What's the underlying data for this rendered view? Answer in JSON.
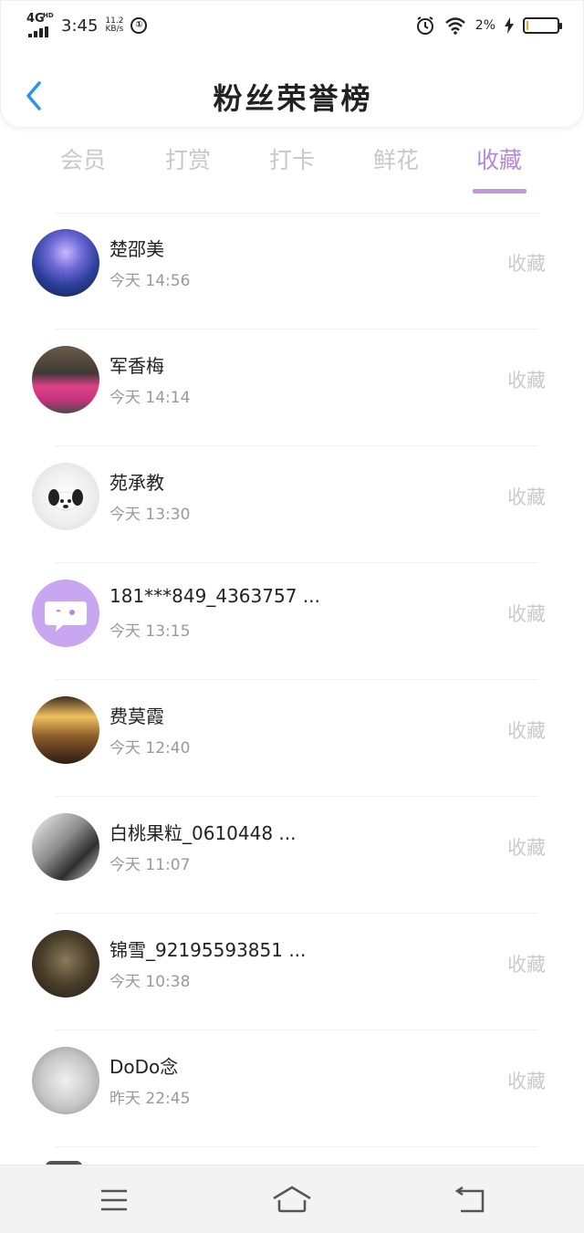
{
  "status_bar": {
    "network": "4G",
    "network_sub": "HD",
    "time": "3:45",
    "speed_value": "11.2",
    "speed_unit": "KB/s",
    "circle_icon": "①",
    "battery": "2%",
    "battery_fill": 0.02,
    "icons": [
      "alarm-icon",
      "wifi-icon",
      "charging-icon",
      "battery-icon"
    ]
  },
  "header": {
    "back_icon": "chevron-left-icon",
    "back_color": "#2a95e6",
    "title": "粉丝荣誉榜"
  },
  "tabs": {
    "items": [
      {
        "label": "会员"
      },
      {
        "label": "打赏"
      },
      {
        "label": "打卡"
      },
      {
        "label": "鲜花"
      },
      {
        "label": "收藏"
      }
    ],
    "active_index": 4,
    "accent_color": "#b48ad8"
  },
  "list": {
    "items": [
      {
        "name": "楚邵美",
        "time": "今天 14:56",
        "action": "收藏"
      },
      {
        "name": "军香梅",
        "time": "今天 14:14",
        "action": "收藏"
      },
      {
        "name": "苑承教",
        "time": "今天 13:30",
        "action": "收藏"
      },
      {
        "name": "181***849_4363757 ...",
        "time": "今天 13:15",
        "action": "收藏"
      },
      {
        "name": "费莫霞",
        "time": "今天 12:40",
        "action": "收藏"
      },
      {
        "name": "白桃果粒_0610448 ...",
        "time": "今天 11:07",
        "action": "收藏"
      },
      {
        "name": "锦雪_92195593851 ...",
        "time": "今天 10:38",
        "action": "收藏"
      },
      {
        "name": "DoDo念",
        "time": "昨天 22:45",
        "action": "收藏"
      }
    ]
  },
  "bottom_nav": {
    "icons": [
      "menu-icon",
      "home-icon",
      "back-icon"
    ]
  }
}
